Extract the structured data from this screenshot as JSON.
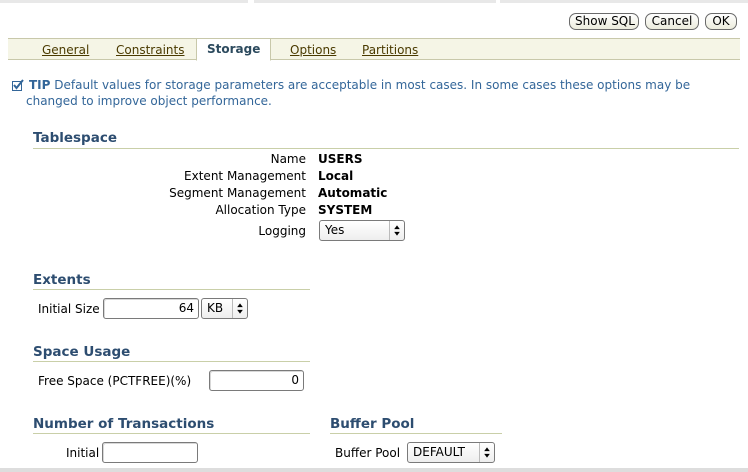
{
  "toolbar": {
    "show_sql": "Show SQL",
    "cancel": "Cancel",
    "ok": "OK"
  },
  "tabs": [
    {
      "label": "General"
    },
    {
      "label": "Constraints"
    },
    {
      "label": "Storage",
      "active": true
    },
    {
      "label": "Options"
    },
    {
      "label": "Partitions"
    }
  ],
  "tip": {
    "label": "TIP",
    "text": "Default values for storage parameters are acceptable in most cases. In some cases these options may be changed to improve object performance."
  },
  "tablespace": {
    "heading": "Tablespace",
    "name_label": "Name",
    "name_value": "USERS",
    "extent_label": "Extent Management",
    "extent_value": "Local",
    "segment_label": "Segment Management",
    "segment_value": "Automatic",
    "allocation_label": "Allocation Type",
    "allocation_value": "SYSTEM",
    "logging_label": "Logging",
    "logging_value": "Yes"
  },
  "extents": {
    "heading": "Extents",
    "initial_size_label": "Initial Size",
    "initial_size_value": "64",
    "unit_value": "KB"
  },
  "space_usage": {
    "heading": "Space Usage",
    "free_space_label": "Free Space (PCTFREE)(%)",
    "free_space_value": "0"
  },
  "transactions": {
    "heading": "Number of Transactions",
    "initial_label": "Initial",
    "initial_value": ""
  },
  "buffer_pool": {
    "heading": "Buffer Pool",
    "label": "Buffer Pool",
    "value": "DEFAULT"
  },
  "icons": {
    "tip": "checkmark-tip-icon",
    "dropdown": "up-down-arrow-icon"
  },
  "colors": {
    "section_heading": "#2d4d70",
    "tip_text": "#336699",
    "tab_bar": "#f5f5e6"
  }
}
